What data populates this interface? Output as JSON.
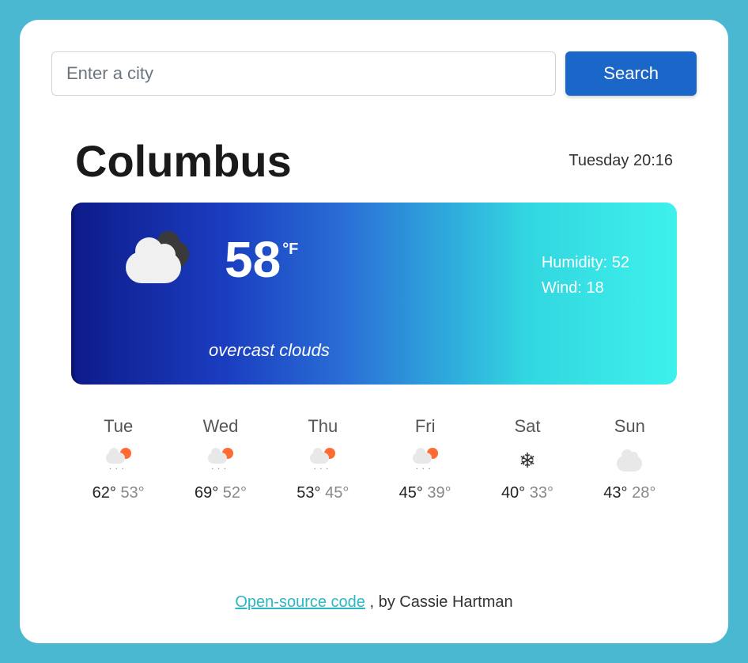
{
  "search": {
    "placeholder": "Enter a city",
    "button_label": "Search"
  },
  "header": {
    "city": "Columbus",
    "datetime": "Tuesday 20:16"
  },
  "current": {
    "temp": "58",
    "unit": "°F",
    "humidity_label": "Humidity: ",
    "humidity_value": "52",
    "wind_label": "Wind: ",
    "wind_value": "18",
    "description": "overcast clouds",
    "icon": "overcast-clouds"
  },
  "forecast": [
    {
      "day": "Tue",
      "icon": "rain-sun",
      "high": "62°",
      "low": "53°"
    },
    {
      "day": "Wed",
      "icon": "rain-sun",
      "high": "69°",
      "low": "52°"
    },
    {
      "day": "Thu",
      "icon": "rain-sun",
      "high": "53°",
      "low": "45°"
    },
    {
      "day": "Fri",
      "icon": "rain-sun",
      "high": "45°",
      "low": "39°"
    },
    {
      "day": "Sat",
      "icon": "snow",
      "high": "40°",
      "low": "33°"
    },
    {
      "day": "Sun",
      "icon": "cloud",
      "high": "43°",
      "low": "28°"
    }
  ],
  "footer": {
    "link_text": "Open-source code",
    "credit": " , by Cassie Hartman"
  }
}
